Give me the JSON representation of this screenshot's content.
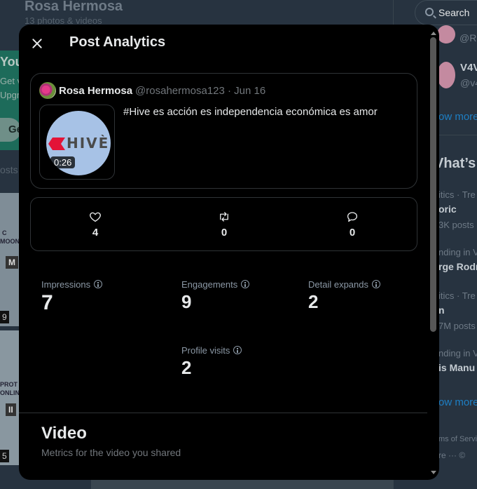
{
  "background": {
    "profile_name": "Rosa Hermosa",
    "profile_sub": "13 photos & videos",
    "promo_title": "You",
    "promo_line1": "Get v",
    "promo_line2": "Upgr",
    "promo_button": "Ge",
    "posts_label": "osts",
    "thumb_badges": [
      "9",
      "5"
    ],
    "thumb_texts": [
      "C",
      "MOON",
      "M",
      "PROT",
      "ONLIN",
      "II"
    ],
    "search_label": "Search",
    "side": {
      "who1": "@R",
      "who2_name": "V4V",
      "who2_handle": "@v4",
      "show_more_1": "ow more",
      "whats": "Vhat’s",
      "trend1_meta": "itics · Tre",
      "trend1_title": "oric",
      "trend1_count": "3K posts",
      "trend2_meta": "nding in V",
      "trend2_title": "rge Rodr",
      "trend3_meta": "itics · Tre",
      "trend3_title": "n",
      "trend3_count": "7M posts",
      "trend4_meta": "nding in V",
      "trend4_title": "is Manu",
      "show_more_2": "ow more",
      "footer1": "ms of Servi",
      "footer2": "re ···  ©"
    }
  },
  "modal": {
    "title": "Post Analytics",
    "post": {
      "author_name": "Rosa Hermosa",
      "author_meta": "@rosahermosa123 · Jun 16",
      "text": "#Hive es acción es independencia económica es amor",
      "video_duration": "0:26",
      "logo_text": "HIVÈ"
    },
    "engagement": {
      "likes": "4",
      "reposts": "0",
      "replies": "0"
    },
    "metrics": {
      "impressions_label": "Impressions",
      "impressions_value": "7",
      "engagements_label": "Engagements",
      "engagements_value": "9",
      "detail_expands_label": "Detail expands",
      "detail_expands_value": "2",
      "profile_visits_label": "Profile visits",
      "profile_visits_value": "2"
    },
    "video_section": {
      "title": "Video",
      "subtitle": "Metrics for the video you shared"
    }
  }
}
